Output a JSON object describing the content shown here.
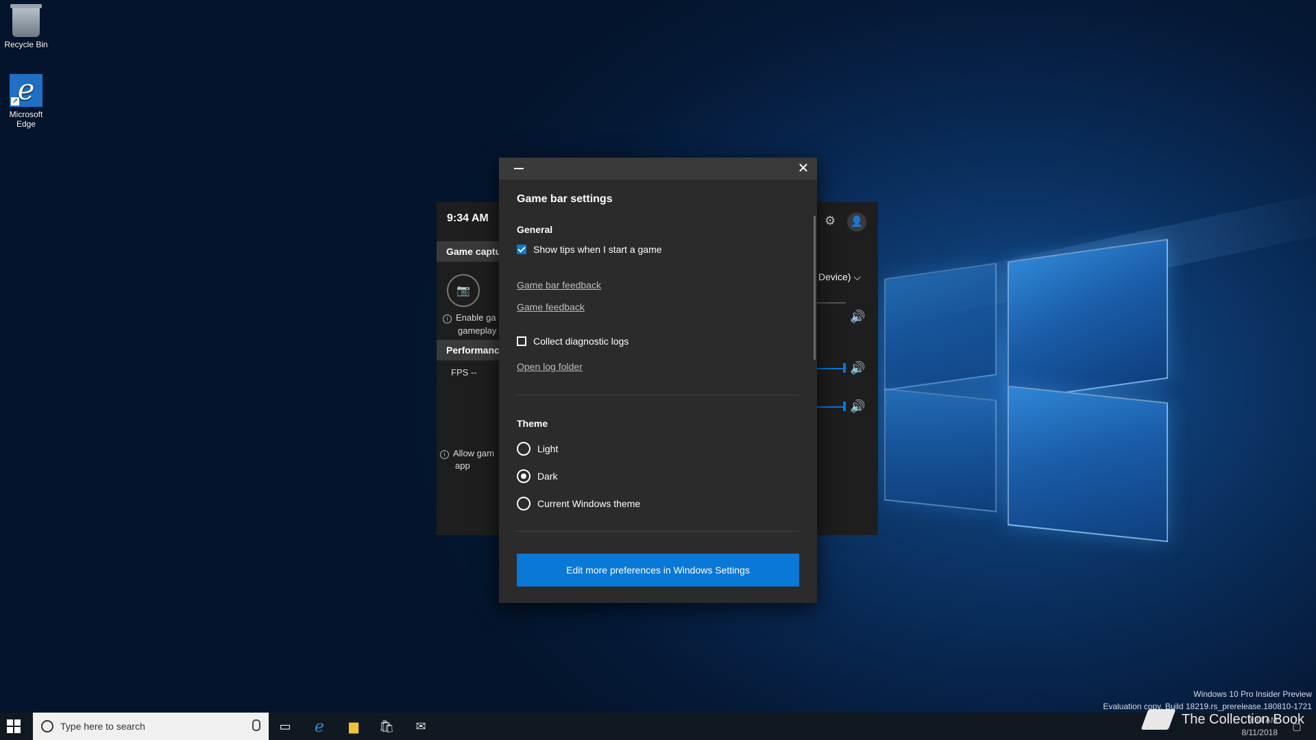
{
  "desktop": {
    "icons": [
      {
        "label": "Recycle Bin"
      },
      {
        "label": "Microsoft Edge"
      }
    ]
  },
  "gamebar": {
    "time": "9:34 AM",
    "capture_header": "Game captu",
    "enable_text_1": "Enable ga",
    "enable_text_2": "gameplay",
    "performance_header": "Performanc",
    "fps": "FPS --",
    "allow_text_1": "Allow gam",
    "allow_text_2": "app",
    "device_label": "Device)"
  },
  "dialog": {
    "title": "Game bar settings",
    "general_title": "General",
    "show_tips_label": "Show tips when I start a game",
    "show_tips_checked": true,
    "game_bar_feedback": "Game bar feedback",
    "game_feedback": "Game feedback",
    "collect_logs_label": "Collect diagnostic logs",
    "collect_logs_checked": false,
    "open_log_folder": "Open log folder",
    "theme_title": "Theme",
    "themes": [
      {
        "label": "Light",
        "selected": false
      },
      {
        "label": "Dark",
        "selected": true
      },
      {
        "label": "Current Windows theme",
        "selected": false
      }
    ],
    "primary_button": "Edit more preferences in Windows Settings"
  },
  "watermark": {
    "line1": "Windows 10 Pro Insider Preview",
    "line2": "Evaluation copy. Build 18219.rs_prerelease.180810-1721",
    "time": "9:34 AM",
    "date": "8/11/2018"
  },
  "taskbar": {
    "search_placeholder": "Type here to search"
  },
  "overlay_brand": "The Collection Book",
  "colors": {
    "accent": "#0a78d7",
    "dialog_bg": "#2b2b2b",
    "titlebar_bg": "#3a3a3a"
  }
}
